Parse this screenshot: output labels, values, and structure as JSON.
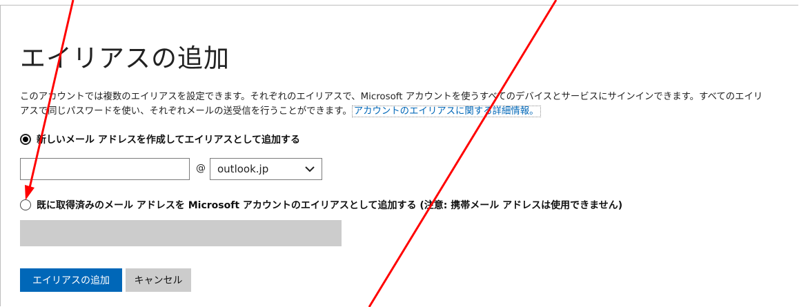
{
  "page": {
    "title": "エイリアスの追加",
    "description_line1": "このアカウントでは複数のエイリアスを設定できます。それぞれのエイリアスで、Microsoft アカウントを使うすべてのデバイスとサービスにサインインできます。すべてのエイリ",
    "description_line2": "アスで同じパスワードを使い、それぞれメールの送受信を行うことができます。",
    "learn_more_link": "アカウントのエイリアスに関する詳細情報。"
  },
  "options": {
    "new_address": {
      "label": "新しいメール アドレスを作成してエイリアスとして追加する",
      "selected": true
    },
    "existing_address": {
      "label": "既に取得済みのメール アドレスを Microsoft アカウントのエイリアスとして追加する",
      "note": "(注意: 携帯メール アドレスは使用できません)",
      "selected": false
    }
  },
  "new_email": {
    "value": "",
    "at_symbol": "@",
    "domain_selected": "outlook.jp"
  },
  "existing_email": {
    "value": ""
  },
  "buttons": {
    "add_alias": "エイリアスの追加",
    "cancel": "キャンセル"
  },
  "colors": {
    "accent": "#0067b8",
    "disabled": "#cccccc",
    "annotation_arrow": "#ff0000"
  }
}
